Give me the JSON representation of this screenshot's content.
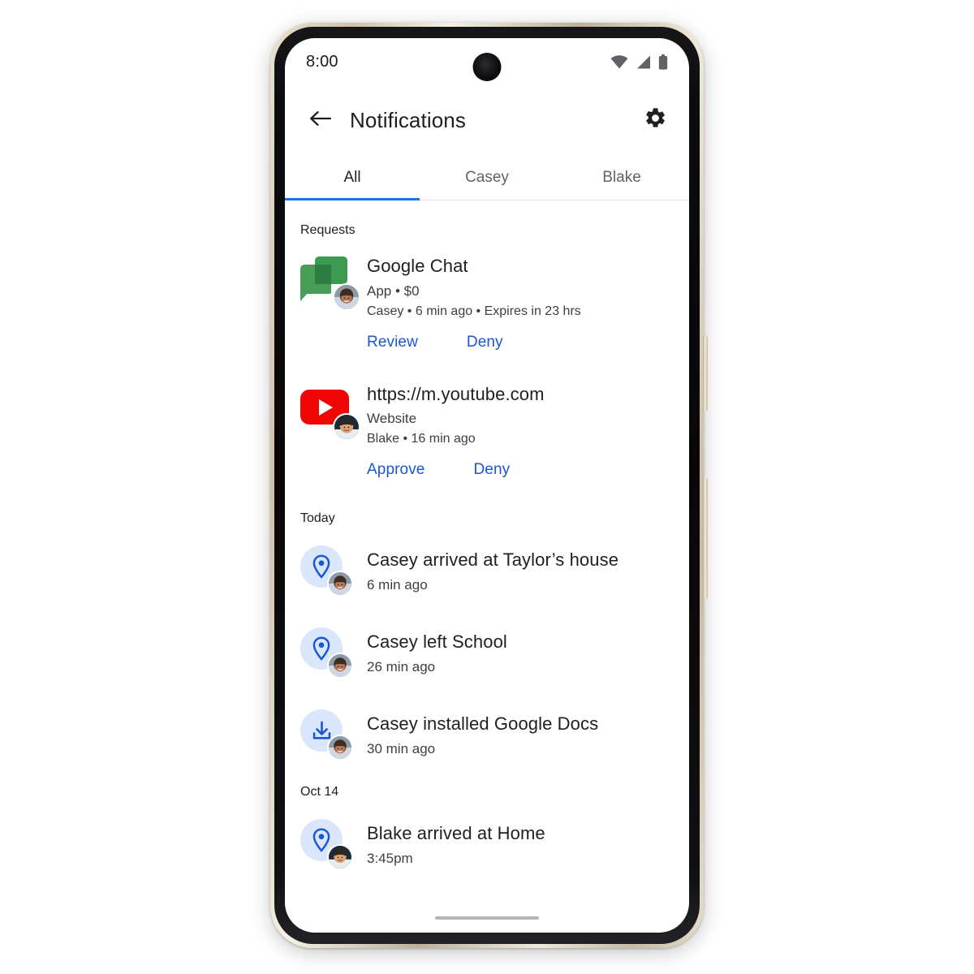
{
  "status_bar": {
    "time": "8:00",
    "icons": [
      "wifi-icon",
      "cellular-signal-icon",
      "battery-icon"
    ]
  },
  "app_bar": {
    "back_icon": "arrow-back-icon",
    "title": "Notifications",
    "settings_icon": "gear-icon"
  },
  "tabs": [
    {
      "label": "All",
      "active": true
    },
    {
      "label": "Casey",
      "active": false
    },
    {
      "label": "Blake",
      "active": false
    }
  ],
  "sections": [
    {
      "heading": "Requests",
      "type": "requests",
      "items": [
        {
          "icon": "google-chat-icon",
          "avatar": "casey-avatar",
          "title": "Google Chat",
          "subtitle": "App • $0",
          "meta": "Casey • 6 min ago • Expires in 23 hrs",
          "actions": [
            "Review",
            "Deny"
          ]
        },
        {
          "icon": "youtube-icon",
          "avatar": "blake-avatar",
          "title": "https://m.youtube.com",
          "subtitle": "Website",
          "meta": "Blake • 16 min ago",
          "actions": [
            "Approve",
            "Deny"
          ]
        }
      ]
    },
    {
      "heading": "Today",
      "type": "events",
      "items": [
        {
          "icon": "location-pin-icon",
          "avatar": "casey-avatar",
          "title": "Casey arrived at Taylor’s house",
          "time": "6 min ago"
        },
        {
          "icon": "location-pin-icon",
          "avatar": "casey-avatar",
          "title": "Casey left School",
          "time": "26 min ago"
        },
        {
          "icon": "download-icon",
          "avatar": "casey-avatar",
          "title": "Casey installed Google Docs",
          "time": "30 min ago"
        }
      ]
    },
    {
      "heading": "Oct 14",
      "type": "events",
      "items": [
        {
          "icon": "location-pin-icon",
          "avatar": "blake-avatar",
          "title": "Blake arrived at Home",
          "time": "3:45pm"
        }
      ]
    }
  ],
  "colors": {
    "accent_blue": "#1a73e8",
    "link_blue": "#1a56d6",
    "icon_bg_blue": "#d9e6fb",
    "youtube_red": "#f00505",
    "chat_green": "#3c9a51",
    "text_primary": "#1f1f1f",
    "text_secondary": "#3c4043"
  },
  "system": {
    "home_indicator": "home-gesture-bar"
  }
}
